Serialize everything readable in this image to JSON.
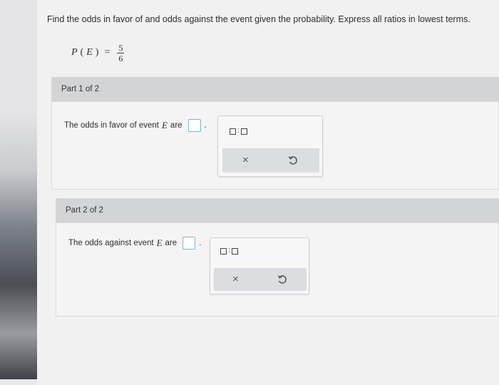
{
  "question": {
    "text": "Find the odds in favor of and odds against the event given the probability. Express all ratios in lowest terms.",
    "probability_label": "P",
    "event_symbol": "E",
    "equals": "=",
    "numerator": "5",
    "denominator": "6"
  },
  "parts": [
    {
      "header": "Part 1 of 2",
      "statement_prefix": "The odds in favor of event",
      "event": "E",
      "statement_suffix": "are",
      "period": "."
    },
    {
      "header": "Part 2 of 2",
      "statement_prefix": "The odds against event",
      "event": "E",
      "statement_suffix": "are",
      "period": "."
    }
  ],
  "toolbox": {
    "clear_symbol": "×",
    "undo_icon": "undo-icon",
    "ratio_icon": "ratio-template-icon"
  }
}
